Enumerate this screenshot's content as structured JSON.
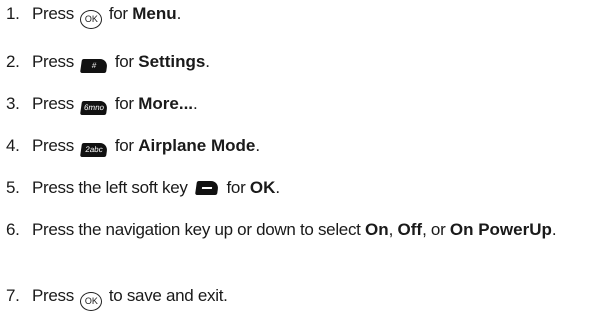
{
  "steps": [
    {
      "number": "1.",
      "pre": "Press",
      "key": "OK",
      "mid": "for",
      "bold": "Menu",
      "post": "."
    },
    {
      "number": "2.",
      "pre": "Press",
      "key": "#",
      "mid": "for",
      "bold": "Settings",
      "post": "."
    },
    {
      "number": "3.",
      "pre": "Press",
      "key": "6mno",
      "mid": "for",
      "bold": "More...",
      "post": "."
    },
    {
      "number": "4.",
      "pre": "Press",
      "key": "2abc",
      "mid": "for",
      "bold": "Airplane Mode",
      "post": "."
    },
    {
      "number": "5.",
      "pre": "Press the left soft key",
      "mid": "for",
      "bold": "OK",
      "post": "."
    },
    {
      "number": "6.",
      "pre": "Press the navigation key up or down to select",
      "bold1": "On",
      "sep1": ",",
      "bold2": "Off",
      "sep2": ", or",
      "bold3": "On PowerUp",
      "post": "."
    },
    {
      "number": "7.",
      "pre": "Press",
      "key": "OK",
      "post": "to save and exit."
    }
  ],
  "icons": {
    "ok": "ok-key-icon",
    "pound": "pound-key-icon",
    "six": "six-key-icon",
    "two": "two-key-icon",
    "soft": "left-soft-key-icon"
  }
}
